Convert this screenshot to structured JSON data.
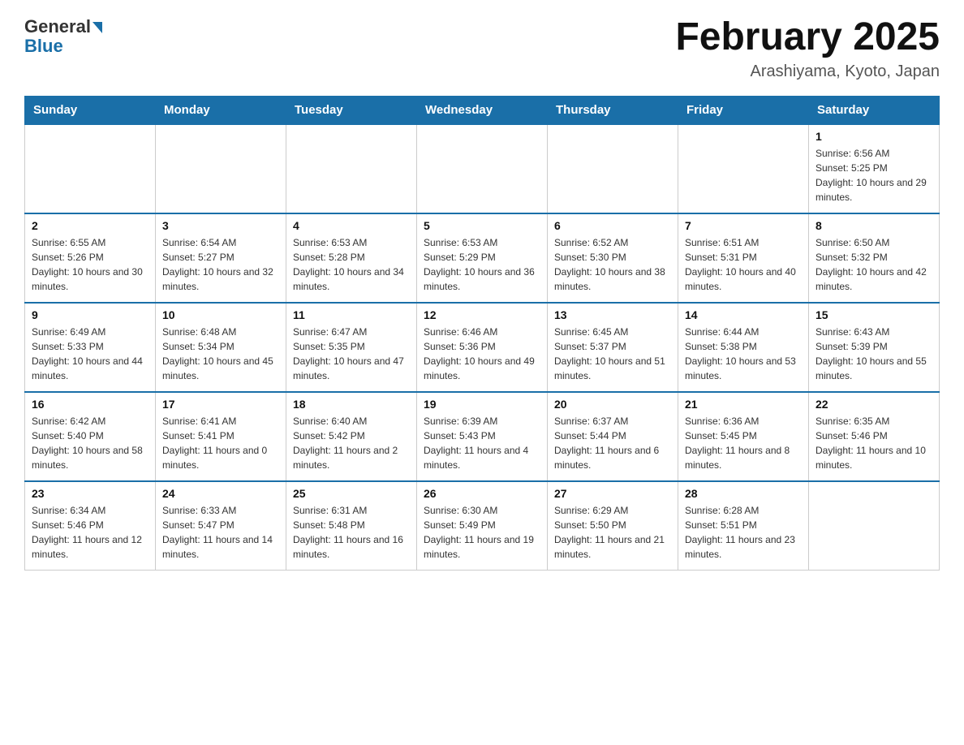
{
  "header": {
    "logo_general": "General",
    "logo_blue": "Blue",
    "month_title": "February 2025",
    "location": "Arashiyama, Kyoto, Japan"
  },
  "weekdays": [
    "Sunday",
    "Monday",
    "Tuesday",
    "Wednesday",
    "Thursday",
    "Friday",
    "Saturday"
  ],
  "weeks": [
    [
      {
        "day": "",
        "info": ""
      },
      {
        "day": "",
        "info": ""
      },
      {
        "day": "",
        "info": ""
      },
      {
        "day": "",
        "info": ""
      },
      {
        "day": "",
        "info": ""
      },
      {
        "day": "",
        "info": ""
      },
      {
        "day": "1",
        "info": "Sunrise: 6:56 AM\nSunset: 5:25 PM\nDaylight: 10 hours and 29 minutes."
      }
    ],
    [
      {
        "day": "2",
        "info": "Sunrise: 6:55 AM\nSunset: 5:26 PM\nDaylight: 10 hours and 30 minutes."
      },
      {
        "day": "3",
        "info": "Sunrise: 6:54 AM\nSunset: 5:27 PM\nDaylight: 10 hours and 32 minutes."
      },
      {
        "day": "4",
        "info": "Sunrise: 6:53 AM\nSunset: 5:28 PM\nDaylight: 10 hours and 34 minutes."
      },
      {
        "day": "5",
        "info": "Sunrise: 6:53 AM\nSunset: 5:29 PM\nDaylight: 10 hours and 36 minutes."
      },
      {
        "day": "6",
        "info": "Sunrise: 6:52 AM\nSunset: 5:30 PM\nDaylight: 10 hours and 38 minutes."
      },
      {
        "day": "7",
        "info": "Sunrise: 6:51 AM\nSunset: 5:31 PM\nDaylight: 10 hours and 40 minutes."
      },
      {
        "day": "8",
        "info": "Sunrise: 6:50 AM\nSunset: 5:32 PM\nDaylight: 10 hours and 42 minutes."
      }
    ],
    [
      {
        "day": "9",
        "info": "Sunrise: 6:49 AM\nSunset: 5:33 PM\nDaylight: 10 hours and 44 minutes."
      },
      {
        "day": "10",
        "info": "Sunrise: 6:48 AM\nSunset: 5:34 PM\nDaylight: 10 hours and 45 minutes."
      },
      {
        "day": "11",
        "info": "Sunrise: 6:47 AM\nSunset: 5:35 PM\nDaylight: 10 hours and 47 minutes."
      },
      {
        "day": "12",
        "info": "Sunrise: 6:46 AM\nSunset: 5:36 PM\nDaylight: 10 hours and 49 minutes."
      },
      {
        "day": "13",
        "info": "Sunrise: 6:45 AM\nSunset: 5:37 PM\nDaylight: 10 hours and 51 minutes."
      },
      {
        "day": "14",
        "info": "Sunrise: 6:44 AM\nSunset: 5:38 PM\nDaylight: 10 hours and 53 minutes."
      },
      {
        "day": "15",
        "info": "Sunrise: 6:43 AM\nSunset: 5:39 PM\nDaylight: 10 hours and 55 minutes."
      }
    ],
    [
      {
        "day": "16",
        "info": "Sunrise: 6:42 AM\nSunset: 5:40 PM\nDaylight: 10 hours and 58 minutes."
      },
      {
        "day": "17",
        "info": "Sunrise: 6:41 AM\nSunset: 5:41 PM\nDaylight: 11 hours and 0 minutes."
      },
      {
        "day": "18",
        "info": "Sunrise: 6:40 AM\nSunset: 5:42 PM\nDaylight: 11 hours and 2 minutes."
      },
      {
        "day": "19",
        "info": "Sunrise: 6:39 AM\nSunset: 5:43 PM\nDaylight: 11 hours and 4 minutes."
      },
      {
        "day": "20",
        "info": "Sunrise: 6:37 AM\nSunset: 5:44 PM\nDaylight: 11 hours and 6 minutes."
      },
      {
        "day": "21",
        "info": "Sunrise: 6:36 AM\nSunset: 5:45 PM\nDaylight: 11 hours and 8 minutes."
      },
      {
        "day": "22",
        "info": "Sunrise: 6:35 AM\nSunset: 5:46 PM\nDaylight: 11 hours and 10 minutes."
      }
    ],
    [
      {
        "day": "23",
        "info": "Sunrise: 6:34 AM\nSunset: 5:46 PM\nDaylight: 11 hours and 12 minutes."
      },
      {
        "day": "24",
        "info": "Sunrise: 6:33 AM\nSunset: 5:47 PM\nDaylight: 11 hours and 14 minutes."
      },
      {
        "day": "25",
        "info": "Sunrise: 6:31 AM\nSunset: 5:48 PM\nDaylight: 11 hours and 16 minutes."
      },
      {
        "day": "26",
        "info": "Sunrise: 6:30 AM\nSunset: 5:49 PM\nDaylight: 11 hours and 19 minutes."
      },
      {
        "day": "27",
        "info": "Sunrise: 6:29 AM\nSunset: 5:50 PM\nDaylight: 11 hours and 21 minutes."
      },
      {
        "day": "28",
        "info": "Sunrise: 6:28 AM\nSunset: 5:51 PM\nDaylight: 11 hours and 23 minutes."
      },
      {
        "day": "",
        "info": ""
      }
    ]
  ]
}
